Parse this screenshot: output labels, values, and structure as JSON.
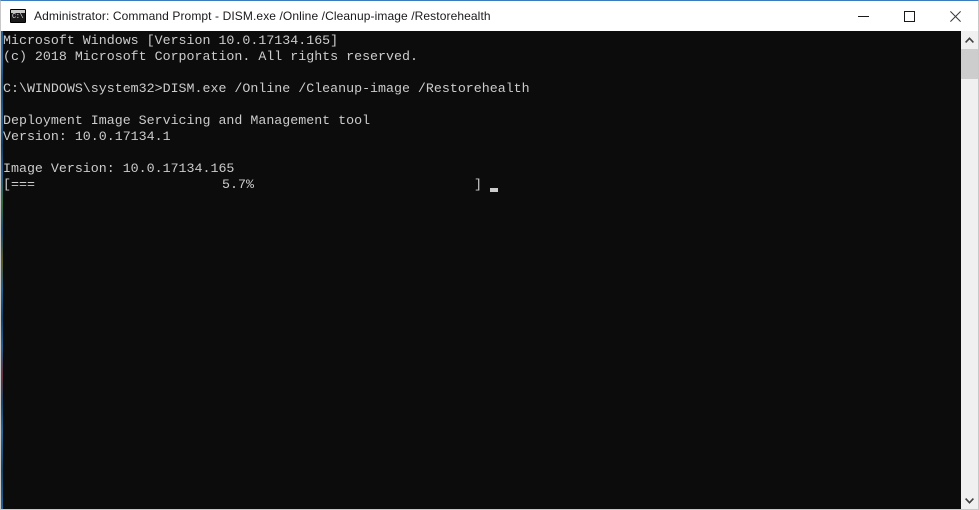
{
  "window": {
    "title": "Administrator: Command Prompt - DISM.exe  /Online /Cleanup-image /Restorehealth",
    "icon": "console-icon",
    "background_color": "#0c0c0c",
    "titlebar_color": "#ffffff",
    "accent_border_color": "#3a7cbf"
  },
  "controls": {
    "minimize_label": "Minimize",
    "maximize_label": "Maximize",
    "close_label": "Close"
  },
  "console": {
    "foreground_color": "#cccccc",
    "lines": [
      "Microsoft Windows [Version 10.0.17134.165]",
      "(c) 2018 Microsoft Corporation. All rights reserved.",
      "",
      "C:\\WINDOWS\\system32>DISM.exe /Online /Cleanup-image /Restorehealth",
      "",
      "Deployment Image Servicing and Management tool",
      "Version: 10.0.17134.1",
      "",
      "Image Version: 10.0.17134.165",
      ""
    ],
    "text_block": "Microsoft Windows [Version 10.0.17134.165]\n(c) 2018 Microsoft Corporation. All rights reserved.\n\nC:\\WINDOWS\\system32>DISM.exe /Online /Cleanup-image /Restorehealth\n\nDeployment Image Servicing and Management tool\nVersion: 10.0.17134.1\n\nImage Version: 10.0.17134.165\n",
    "command": "DISM.exe /Online /Cleanup-image /Restorehealth",
    "prompt": "C:\\WINDOWS\\system32>",
    "tool_name": "Deployment Image Servicing and Management tool",
    "tool_version": "Version: 10.0.17134.1",
    "image_version": "Image Version: 10.0.17134.165"
  },
  "progress": {
    "bar_left": "[===",
    "percent": "5.7%",
    "percent_value": 5.7,
    "bar_right": "]",
    "cursor": "block-cursor"
  },
  "scrollbar": {
    "up_arrow": "chevron-up-icon",
    "down_arrow": "chevron-down-icon",
    "thumb": "scrollbar-thumb"
  }
}
